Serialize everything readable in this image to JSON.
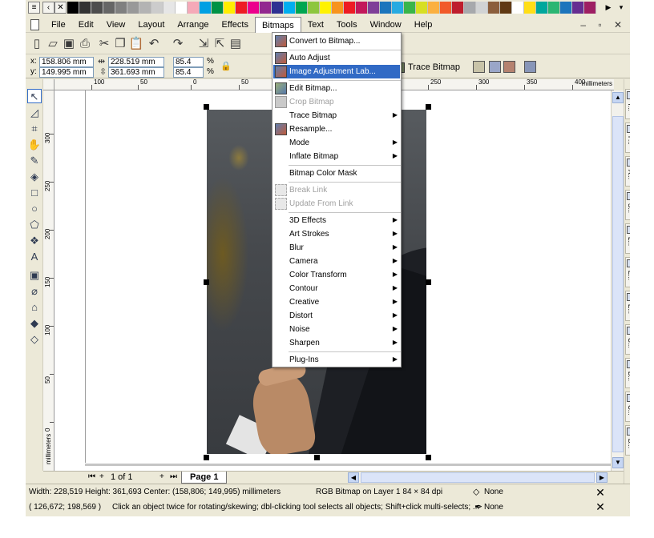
{
  "app": {
    "menu": [
      "File",
      "Edit",
      "View",
      "Layout",
      "Arrange",
      "Effects",
      "Bitmaps",
      "Text",
      "Tools",
      "Window",
      "Help"
    ],
    "open_menu": "Bitmaps",
    "window_controls": "– ▫ ✕"
  },
  "palette_top": [
    "#000000",
    "#333333",
    "#4d4d4d",
    "#666666",
    "#808080",
    "#999999",
    "#b3b3b3",
    "#cccccc",
    "#e6e6e6",
    "#ffffff",
    "#f5a9b8",
    "#00a0e3",
    "#009245",
    "#ffed00",
    "#ee1d24",
    "#ec008c",
    "#92278f",
    "#2e3192",
    "#00aeef",
    "#00a651",
    "#8dc63f",
    "#fff200",
    "#f7941d",
    "#ed1c24",
    "#c2185b",
    "#7f3f98",
    "#1b75bc",
    "#27aae1",
    "#39b54a",
    "#d7df23",
    "#fbb040",
    "#f15a29",
    "#be1e2d",
    "#a7a9ac",
    "#d1d3d4",
    "#8b5e3c",
    "#603913",
    "#ffffff",
    "#ffde17",
    "#00a79d",
    "#2bb673",
    "#1c75bc",
    "#662d91",
    "#9e1f63"
  ],
  "palette_right": [
    "#000000",
    "#1a1a1a",
    "#333333",
    "#4d4d4d",
    "#666666",
    "#808080",
    "#999999",
    "#b3b3b3",
    "#cccccc",
    "#e6e6e6",
    "#ffffff",
    "#5c2d91",
    "#0072bc",
    "#00a651",
    "#8dc63f",
    "#fff200",
    "#f7941d",
    "#ed1c24",
    "#c2185b",
    "#ec008c",
    "#f49ac1",
    "#a67c52",
    "#8b4513",
    "#00aeef",
    "#27aae1",
    "#1b1464",
    "#2e3192",
    "#92278f",
    "#0054a6",
    "#00a99d"
  ],
  "property_bar": {
    "x_label": "x:",
    "x_value": "158.806 mm",
    "y_label": "y:",
    "y_value": "149.995 mm",
    "w_value": "228.519 mm",
    "h_value": "361.693 mm",
    "scale_w": "85.4",
    "scale_h": "85.4",
    "pct_w": "%",
    "pct_h": "%",
    "trace_label": "Trace Bitmap"
  },
  "ruler": {
    "h_ticks": [
      "100",
      "50",
      "0",
      "50",
      "250",
      "300",
      "350",
      "400"
    ],
    "h_unit": "millimeters",
    "v_ticks": [
      "300",
      "250",
      "200",
      "150",
      "100",
      "50",
      "0"
    ],
    "v_unit": "millimeters"
  },
  "bitmaps_menu": [
    {
      "type": "item",
      "label": "Convert to Bitmap...",
      "icon": "convert-bitmap-icon",
      "state": "normal"
    },
    {
      "type": "sep"
    },
    {
      "type": "item",
      "label": "Auto Adjust",
      "icon": "auto-adjust-icon",
      "state": "normal"
    },
    {
      "type": "item",
      "label": "Image Adjustment Lab...",
      "icon": "image-adjustment-icon",
      "state": "highlighted"
    },
    {
      "type": "sep"
    },
    {
      "type": "item",
      "label": "Edit Bitmap...",
      "icon": "edit-bitmap-icon",
      "state": "normal"
    },
    {
      "type": "item",
      "label": "Crop Bitmap",
      "icon": "crop-bitmap-icon",
      "state": "disabled"
    },
    {
      "type": "item",
      "label": "Trace Bitmap",
      "icon": "",
      "state": "normal",
      "submenu": true
    },
    {
      "type": "item",
      "label": "Resample...",
      "icon": "resample-icon",
      "state": "normal"
    },
    {
      "type": "item",
      "label": "Mode",
      "icon": "",
      "state": "normal",
      "submenu": true
    },
    {
      "type": "item",
      "label": "Inflate Bitmap",
      "icon": "",
      "state": "normal",
      "submenu": true
    },
    {
      "type": "sep"
    },
    {
      "type": "item",
      "label": "Bitmap Color Mask",
      "icon": "",
      "state": "normal"
    },
    {
      "type": "sep"
    },
    {
      "type": "item",
      "label": "Break Link",
      "icon": "break-link-icon",
      "state": "disabled"
    },
    {
      "type": "item",
      "label": "Update From Link",
      "icon": "update-link-icon",
      "state": "disabled"
    },
    {
      "type": "sep"
    },
    {
      "type": "item",
      "label": "3D Effects",
      "icon": "",
      "state": "normal",
      "submenu": true
    },
    {
      "type": "item",
      "label": "Art Strokes",
      "icon": "",
      "state": "normal",
      "submenu": true
    },
    {
      "type": "item",
      "label": "Blur",
      "icon": "",
      "state": "normal",
      "submenu": true
    },
    {
      "type": "item",
      "label": "Camera",
      "icon": "",
      "state": "normal",
      "submenu": true
    },
    {
      "type": "item",
      "label": "Color Transform",
      "icon": "",
      "state": "normal",
      "submenu": true
    },
    {
      "type": "item",
      "label": "Contour",
      "icon": "",
      "state": "normal",
      "submenu": true
    },
    {
      "type": "item",
      "label": "Creative",
      "icon": "",
      "state": "normal",
      "submenu": true
    },
    {
      "type": "item",
      "label": "Distort",
      "icon": "",
      "state": "normal",
      "submenu": true
    },
    {
      "type": "item",
      "label": "Noise",
      "icon": "",
      "state": "normal",
      "submenu": true
    },
    {
      "type": "item",
      "label": "Sharpen",
      "icon": "",
      "state": "normal",
      "submenu": true
    },
    {
      "type": "sep"
    },
    {
      "type": "item",
      "label": "Plug-Ins",
      "icon": "",
      "state": "normal",
      "submenu": true
    }
  ],
  "page_nav": {
    "count": "1 of 1",
    "tab": "Page 1"
  },
  "status": {
    "line1_left": "Width: 228,519  Height: 361,693  Center: (158,806; 149,995)  millimeters",
    "line1_mid": "RGB Bitmap on Layer 1 84 × 84 dpi",
    "line1_fill": "None",
    "line2_left": "( 126,672; 198,569 )",
    "line2_hint": "Click an object twice for rotating/skewing; dbl-clicking tool selects all objects; Shift+click multi-selects; ...",
    "line2_outline": "None"
  },
  "dockers": [
    "T...",
    "F...",
    "A...",
    "S...",
    "L...",
    "E...",
    "E...",
    "C...",
    "B...",
    "C...",
    "B..."
  ]
}
